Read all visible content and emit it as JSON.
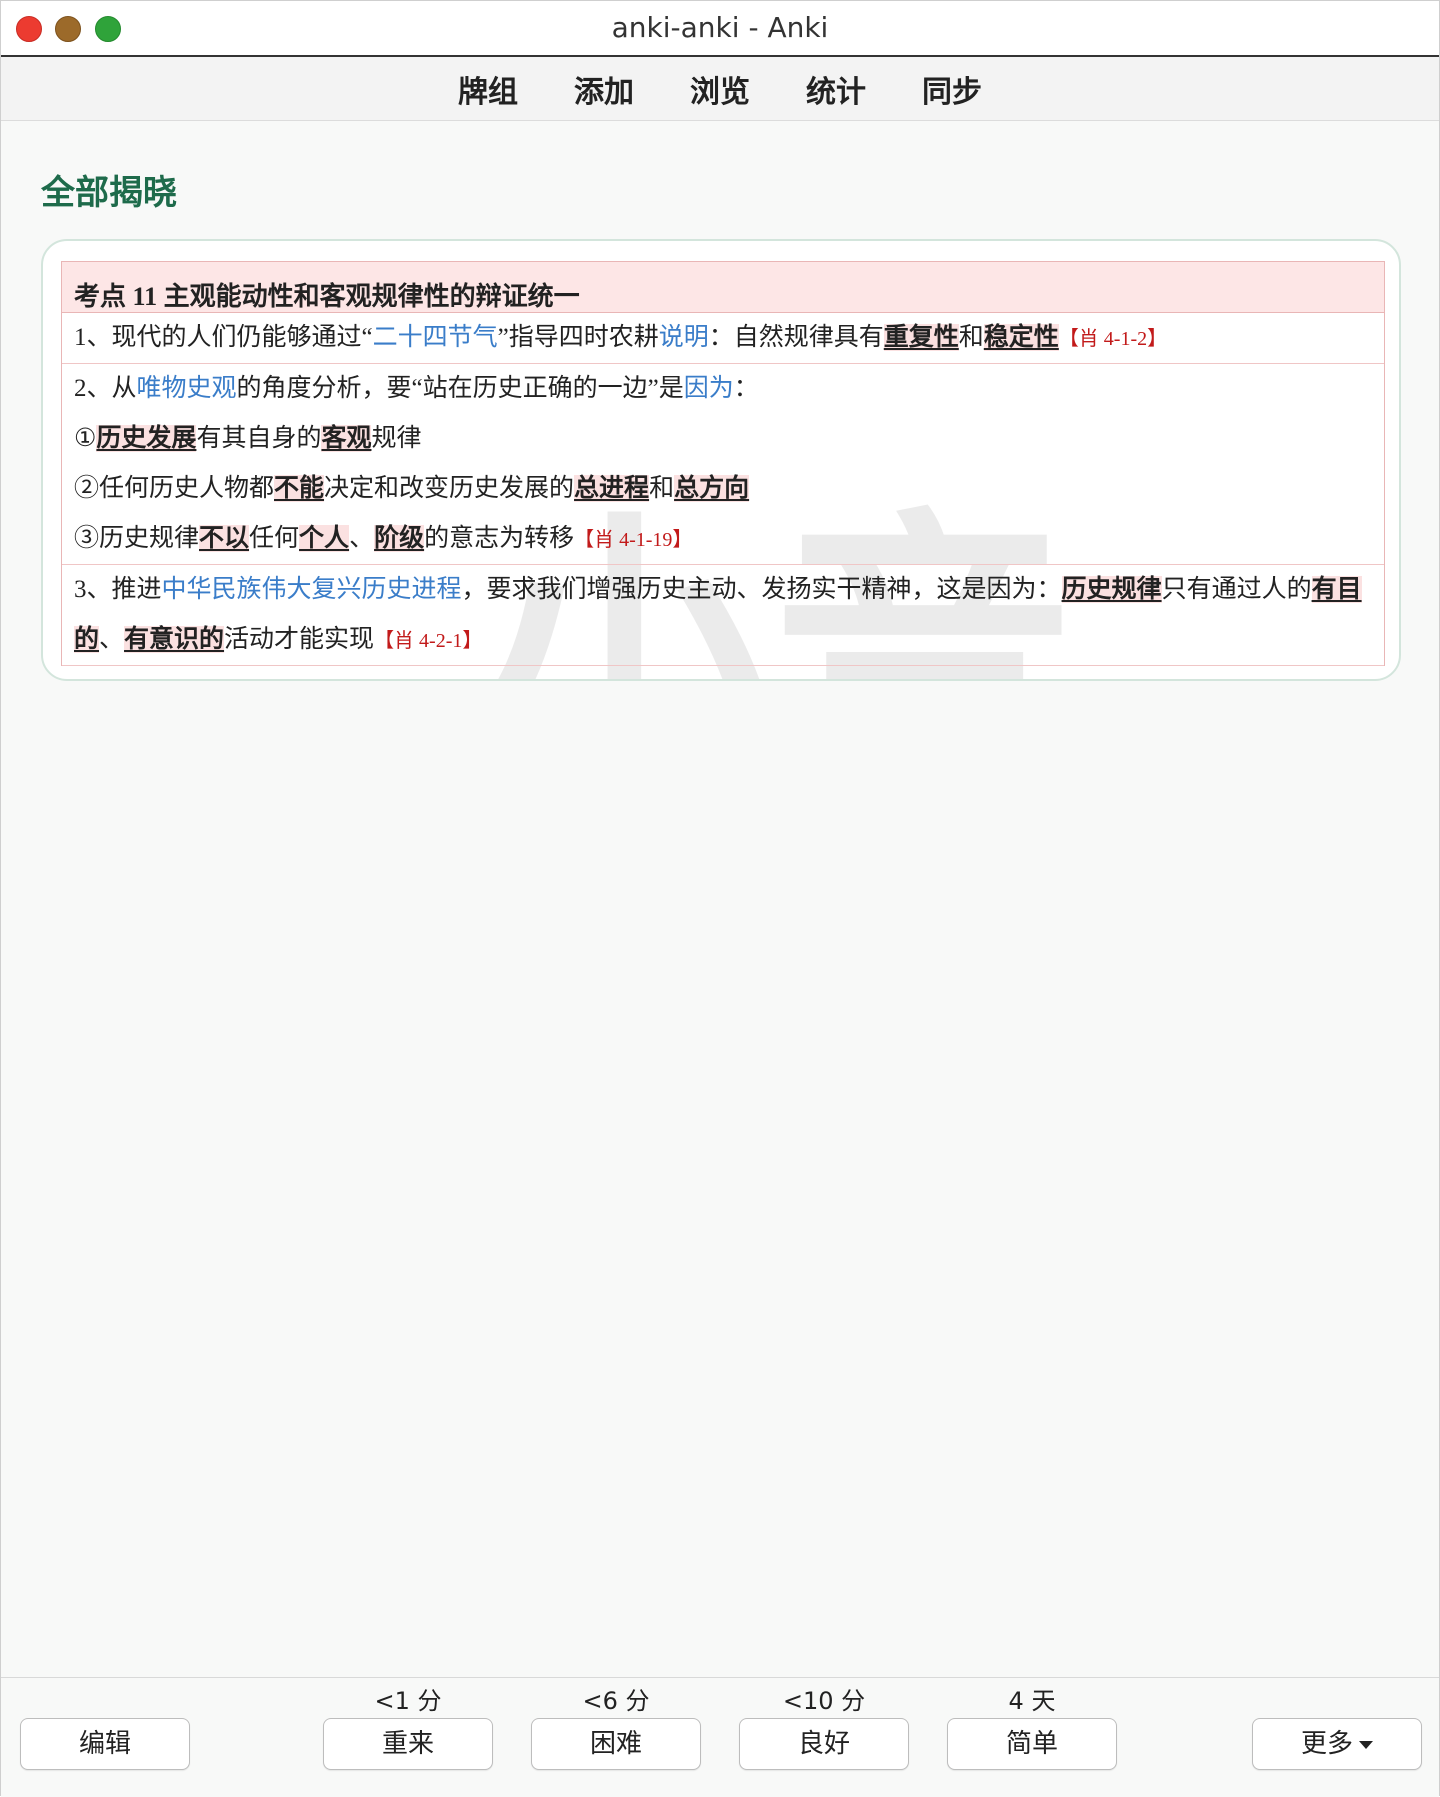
{
  "window": {
    "title": "anki-anki - Anki"
  },
  "toolbar": {
    "items": [
      "牌组",
      "添加",
      "浏览",
      "统计",
      "同步"
    ]
  },
  "page": {
    "heading": "全部揭晓"
  },
  "card": {
    "header": "考点 11  主观能动性和客观规律性的辩证统一",
    "item1": {
      "t1": "1、现代的人们仍能够通过“",
      "t2": "二十四节气",
      "t3": "”指导四时农耕",
      "t4": "说明",
      "t5": "：自然规律具有",
      "t6": "重复性",
      "t7": "和",
      "t8": "稳定性",
      "ref": "【肖 4-1-2】"
    },
    "item2": {
      "l1a": "2、从",
      "l1b": "唯物史观",
      "l1c": "的角度分析，要“站在历史正确的一边”是",
      "l1d": "因为",
      "l1e": "：",
      "l2a": "①",
      "l2b": "历史发展",
      "l2c": "有其自身的",
      "l2d": "客观",
      "l2e": "规律",
      "l3a": "②任何历史人物都",
      "l3b": "不能",
      "l3c": "决定和改变历史发展的",
      "l3d": "总进程",
      "l3e": "和",
      "l3f": "总方向",
      "l4a": "③历史规律",
      "l4b": "不以",
      "l4c": "任何",
      "l4d": "个人",
      "l4e": "、",
      "l4f": "阶级",
      "l4g": "的意志为转移",
      "ref": "【肖 4-1-19】"
    },
    "item3": {
      "a": "3、推进",
      "b": "中华民族伟大复兴历史进程",
      "c": "，要求我们增强历史主动、发扬实干精神，这是因为：",
      "d": "历史规律",
      "e": "只有通过人的",
      "f": "有目",
      "g": "的",
      "h": "、",
      "i": "有意识的",
      "j": "活动才能实现",
      "ref": "【肖 4-2-1】"
    }
  },
  "answer_bar": {
    "edit": "编辑",
    "intervals": [
      "<1 分",
      "<6 分",
      "<10 分",
      "4 天"
    ],
    "buttons": [
      "重来",
      "困难",
      "良好",
      "简单"
    ],
    "more": "更多"
  },
  "colors": {
    "heading": "#1e6b4b",
    "link": "#3a7dc9",
    "highlight": "#fbe1e1",
    "reference": "#c21a1a"
  }
}
